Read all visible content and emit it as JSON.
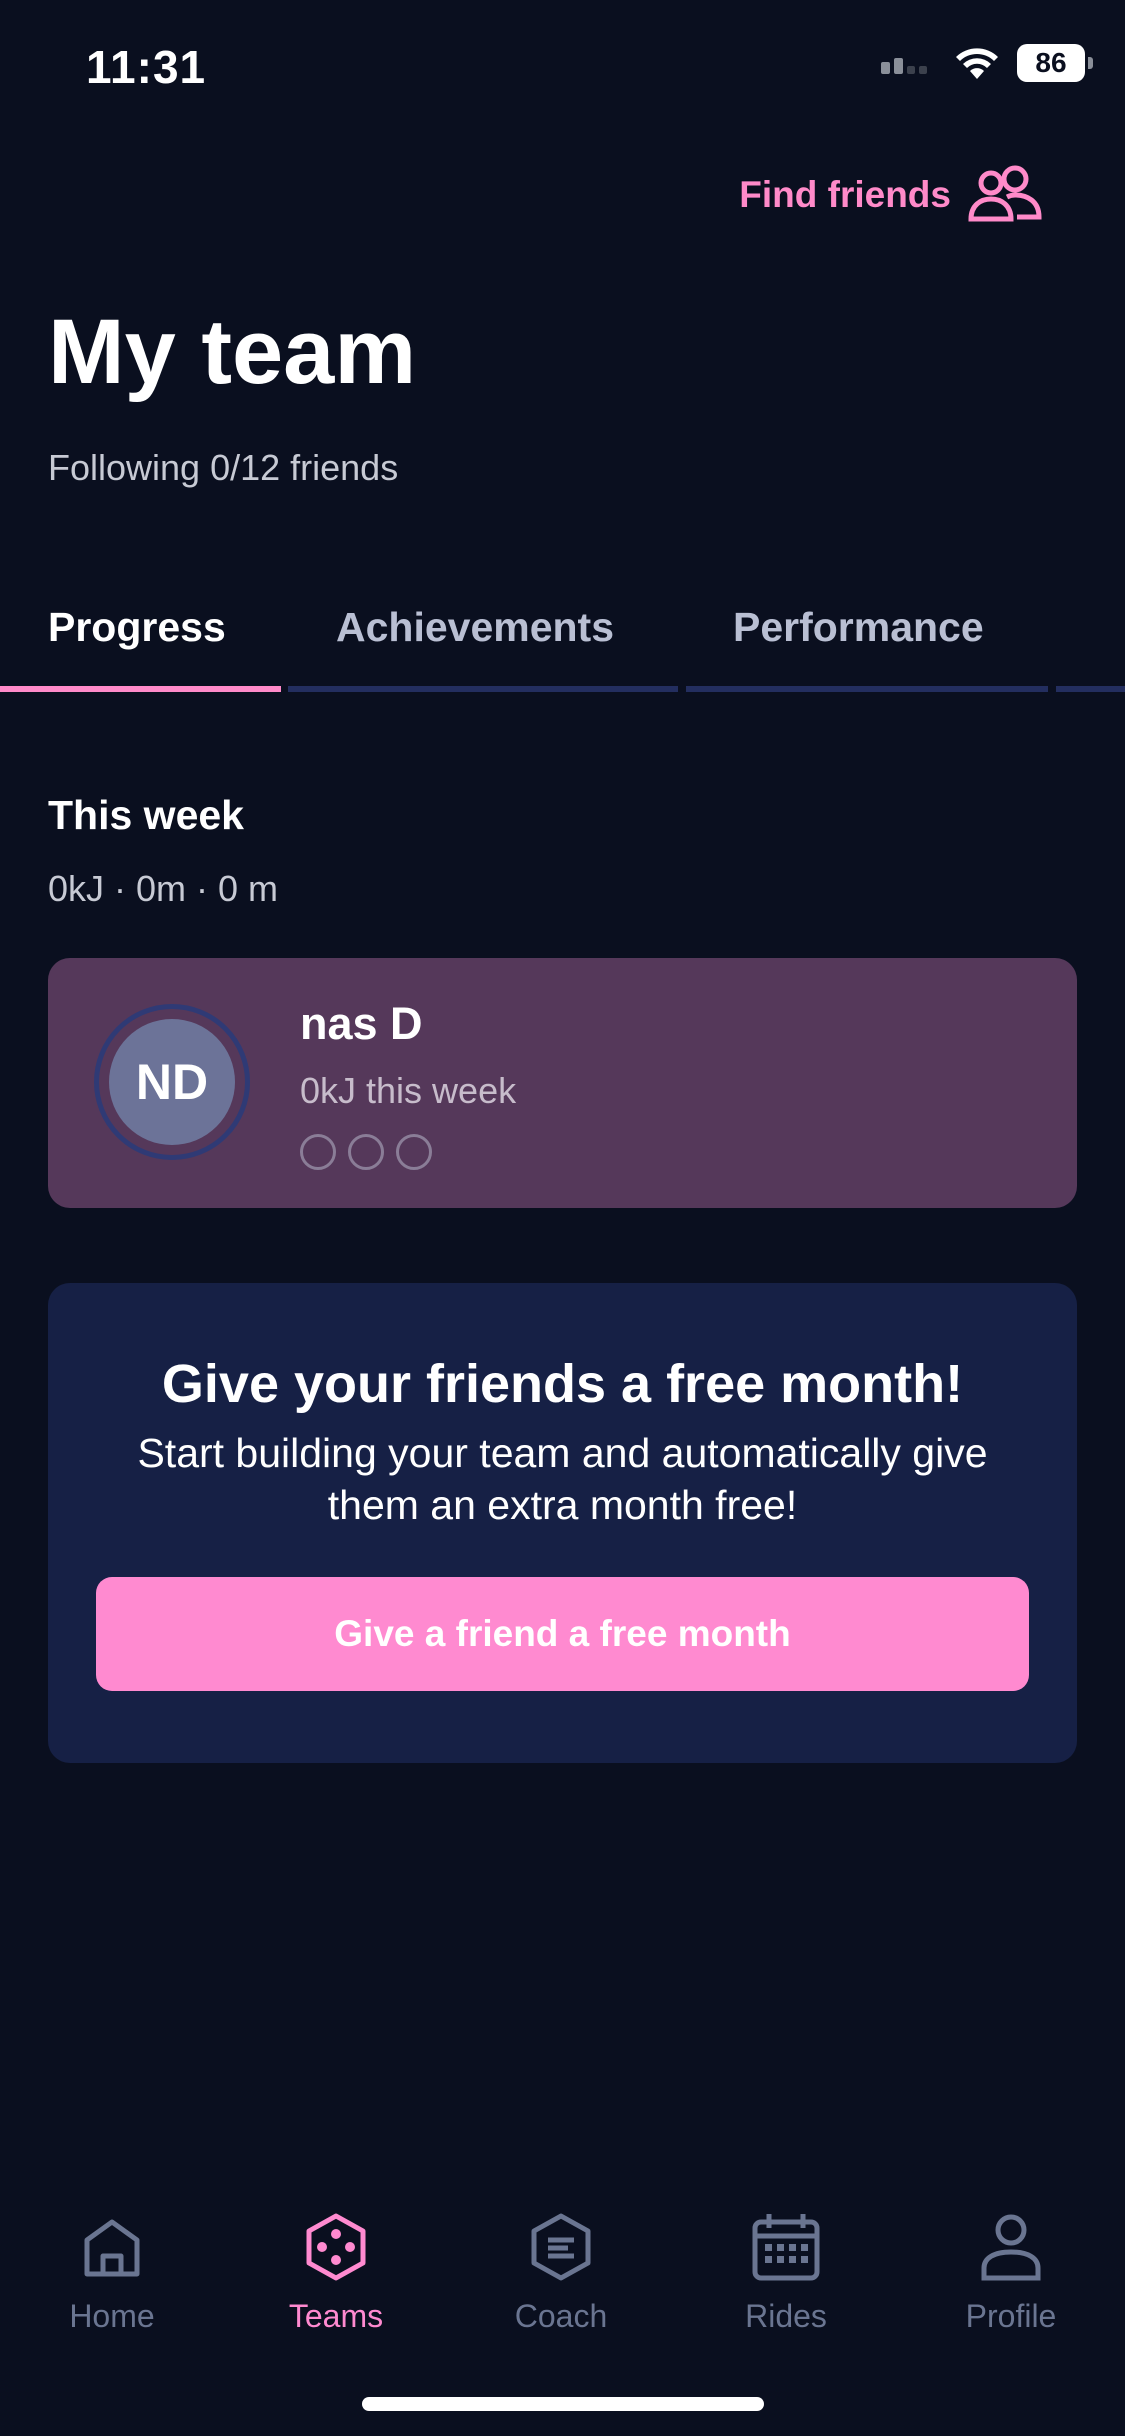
{
  "status_bar": {
    "time": "11:31",
    "battery": "86"
  },
  "header": {
    "find_friends_label": "Find friends",
    "title": "My team",
    "following": "Following 0/12 friends"
  },
  "tabs": [
    {
      "label": "Progress",
      "active": true
    },
    {
      "label": "Achievements",
      "active": false
    },
    {
      "label": "Performance",
      "active": false
    }
  ],
  "week": {
    "title": "This week",
    "stats": "0kJ · 0m · 0 m"
  },
  "member": {
    "initials": "ND",
    "name": "nas D",
    "subtitle": "0kJ this week"
  },
  "promo": {
    "title": "Give your friends a free month!",
    "text": "Start building your team and automatically give them an extra month free!",
    "button_label": "Give a friend a free month"
  },
  "nav": [
    {
      "label": "Home",
      "icon": "home-icon",
      "active": false
    },
    {
      "label": "Teams",
      "icon": "teams-icon",
      "active": true
    },
    {
      "label": "Coach",
      "icon": "coach-icon",
      "active": false
    },
    {
      "label": "Rides",
      "icon": "calendar-icon",
      "active": false
    },
    {
      "label": "Profile",
      "icon": "profile-icon",
      "active": false
    }
  ],
  "colors": {
    "background": "#0a0f1f",
    "accent_pink": "#ff8ad0",
    "card_member": "#55385a",
    "card_promo": "#162045"
  }
}
